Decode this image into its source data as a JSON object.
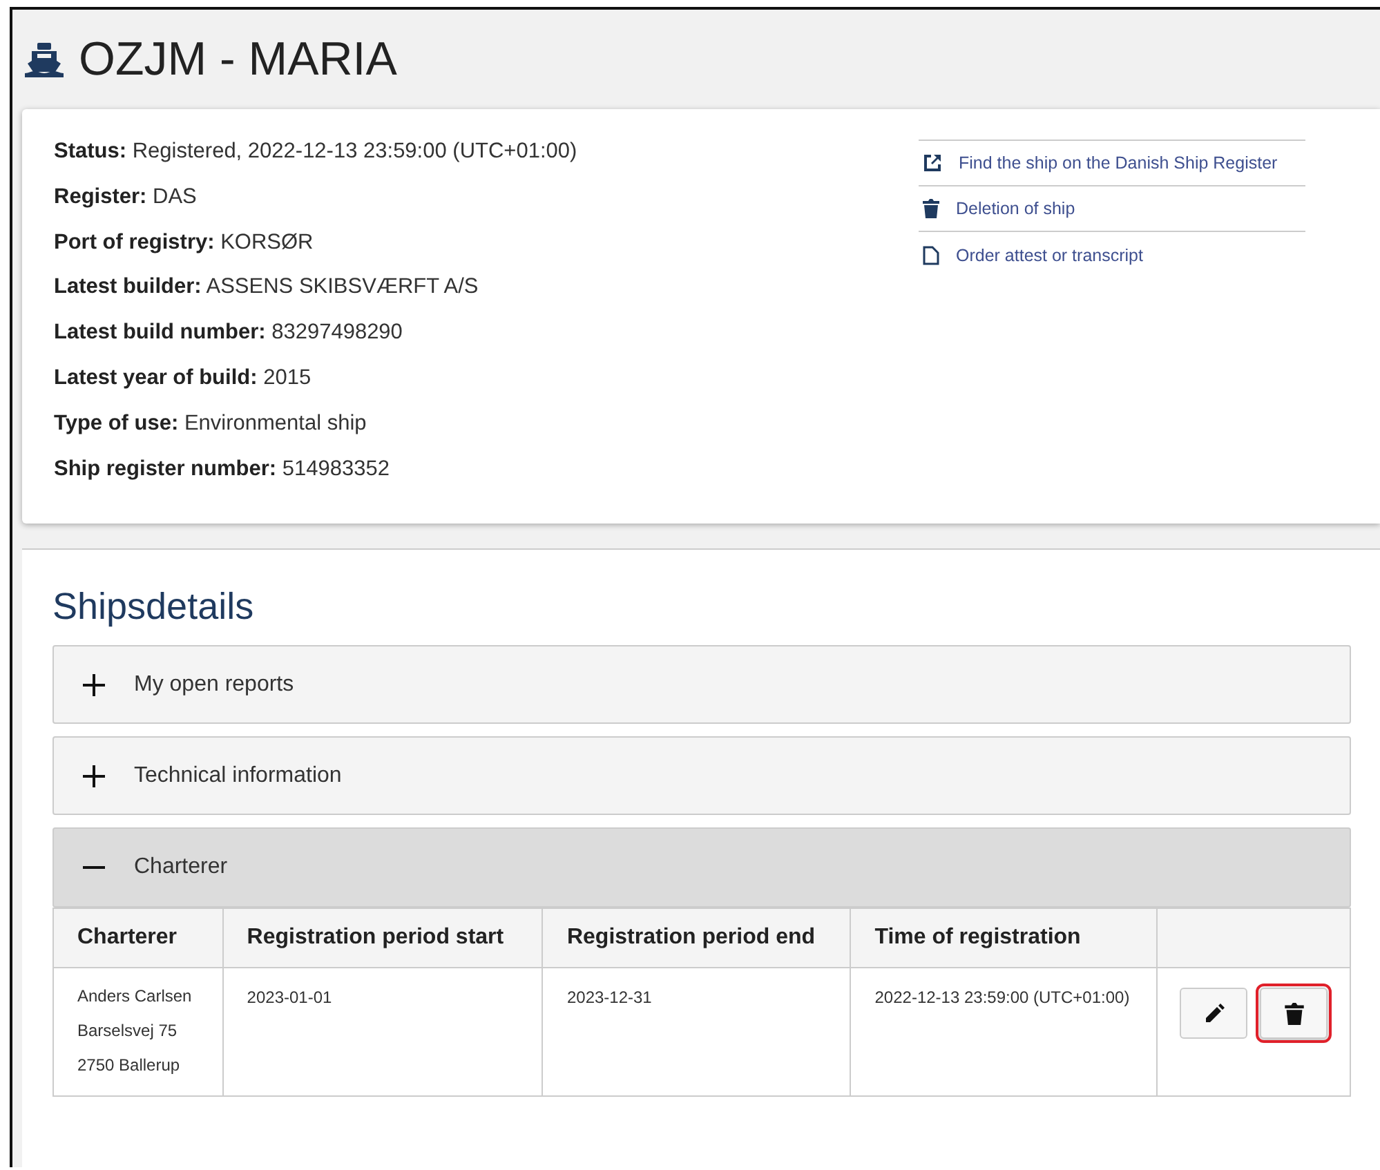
{
  "header": {
    "title": "OZJM - MARIA"
  },
  "info": {
    "fields": [
      {
        "label": "Status:",
        "value": "Registered, 2022-12-13 23:59:00 (UTC+01:00)"
      },
      {
        "label": "Register:",
        "value": "DAS"
      },
      {
        "label": "Port of registry:",
        "value": "KORSØR"
      },
      {
        "label": "Latest builder:",
        "value": "ASSENS SKIBSVÆRFT A/S"
      },
      {
        "label": "Latest build number:",
        "value": "83297498290"
      },
      {
        "label": "Latest year of build:",
        "value": "2015"
      },
      {
        "label": "Type of use:",
        "value": "Environmental ship"
      },
      {
        "label": "Ship register number:",
        "value": "514983352"
      }
    ],
    "links": [
      {
        "kind": "external",
        "label": "Find the ship on the Danish Ship Register"
      },
      {
        "kind": "delete",
        "label": "Deletion of ship"
      },
      {
        "kind": "document",
        "label": "Order attest or transcript"
      }
    ]
  },
  "details": {
    "title": "Shipsdetails",
    "sections": [
      {
        "title": "My open reports",
        "expanded": false
      },
      {
        "title": "Technical information",
        "expanded": false
      },
      {
        "title": "Charterer",
        "expanded": true,
        "table": {
          "columns": [
            "Charterer",
            "Registration period start",
            "Registration period end",
            "Time of registration"
          ],
          "rows": [
            {
              "charterer": [
                "Anders Carlsen",
                "Barselsvej 75",
                "2750 Ballerup"
              ],
              "start": "2023-01-01",
              "end": "2023-12-31",
              "registered": "2022-12-13 23:59:00 (UTC+01:00)",
              "actions": [
                {
                  "kind": "edit",
                  "highlighted": false
                },
                {
                  "kind": "delete",
                  "highlighted": true
                }
              ]
            }
          ]
        }
      }
    ]
  }
}
